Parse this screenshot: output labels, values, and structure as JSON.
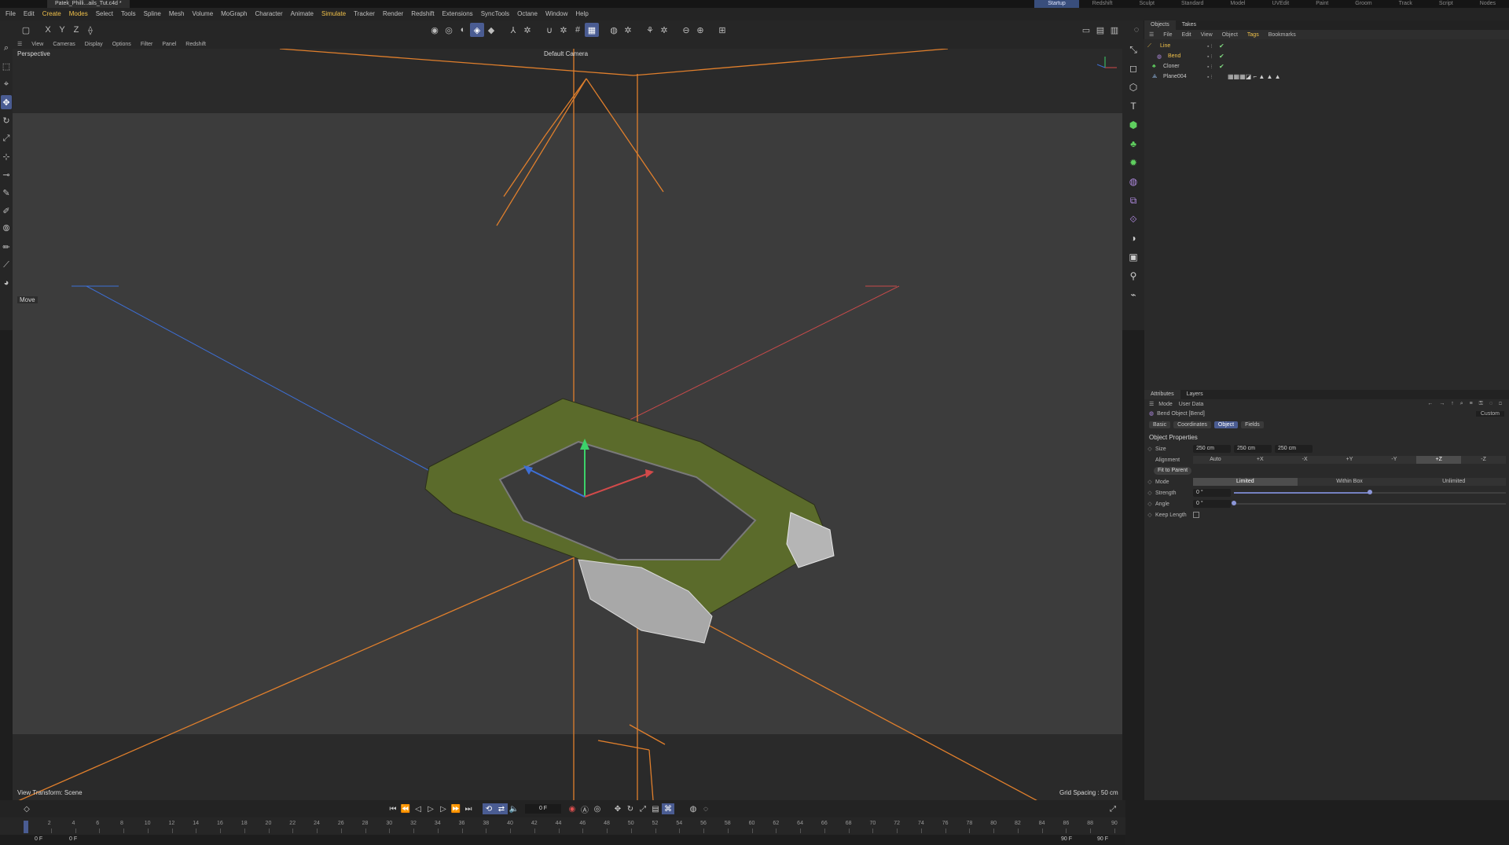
{
  "titlebar": {
    "tab": "Patek_Philli...ails_Tut.c4d *",
    "layouts": [
      "Startup",
      "Redshift",
      "Sculpt",
      "Standard",
      "Model",
      "UVEdit",
      "Paint",
      "Groom",
      "Track",
      "Script",
      "Nodes"
    ],
    "active_layout": "Startup"
  },
  "menubar": [
    "File",
    "Edit",
    "Create",
    "Modes",
    "Select",
    "Tools",
    "Spline",
    "Mesh",
    "Volume",
    "MoGraph",
    "Character",
    "Animate",
    "Simulate",
    "Tracker",
    "Render",
    "Redshift",
    "Extensions",
    "SyncTools",
    "Octane",
    "Window",
    "Help"
  ],
  "toolbar": {
    "axes": [
      "X",
      "Y",
      "Z"
    ]
  },
  "viewport_menu": [
    "View",
    "Cameras",
    "Display",
    "Options",
    "Filter",
    "Panel",
    "Redshift"
  ],
  "viewport": {
    "name": "Perspective",
    "camera": "Default Camera",
    "tool": "Move",
    "view_transform": "View Transform: Scene",
    "grid_spacing": "Grid Spacing : 50 cm",
    "colors": {
      "bg": "#3b3b3b",
      "floor": "#444444",
      "deformer": "#e07f2c",
      "axis_x": "#c84a4a",
      "axis_z": "#3d6fd6"
    }
  },
  "objects_panel": {
    "tabs": [
      "Objects",
      "Takes"
    ],
    "menu": [
      "File",
      "Edit",
      "View",
      "Object",
      "Tags",
      "Bookmarks"
    ],
    "rows": [
      {
        "name": "Line",
        "color": "#f0c14a"
      },
      {
        "name": "Bend",
        "color": "#f0c14a"
      },
      {
        "name": "Cloner",
        "color": "#c8c8c8"
      },
      {
        "name": "Plane004",
        "color": "#c8c8c8"
      }
    ]
  },
  "attributes_panel": {
    "tabs": [
      "Attributes",
      "Layers"
    ],
    "mode_menu": [
      "Mode",
      "User Data"
    ],
    "object_title": "Bend Object [Bend]",
    "preset": "Custom",
    "sub_tabs": [
      "Basic",
      "Coordinates",
      "Object",
      "Fields"
    ],
    "active_sub_tab": "Object",
    "section": "Object Properties",
    "size_label": "Size",
    "size": [
      "250 cm",
      "250 cm",
      "250 cm"
    ],
    "alignment_label": "Alignment",
    "alignment_options": [
      "Auto",
      "+X",
      "-X",
      "+Y",
      "-Y",
      "+Z",
      "-Z"
    ],
    "alignment_selected": "+Z",
    "fit_button": "Fit to Parent",
    "mode_label": "Mode",
    "mode_options": [
      "Limited",
      "Within Box",
      "Unlimited"
    ],
    "mode_selected": "Limited",
    "strength_label": "Strength",
    "strength": "0 °",
    "strength_level": 0.5,
    "angle_label": "Angle",
    "angle": "0 °",
    "angle_level": 0.0,
    "keep_length_label": "Keep Length"
  },
  "timeline": {
    "current_frame": "0 F",
    "ticks": [
      "0",
      "2",
      "4",
      "6",
      "8",
      "10",
      "12",
      "14",
      "16",
      "18",
      "20",
      "22",
      "24",
      "26",
      "28",
      "30",
      "32",
      "34",
      "36",
      "38",
      "40",
      "42",
      "44",
      "46",
      "48",
      "50",
      "52",
      "54",
      "56",
      "58",
      "60",
      "62",
      "64",
      "66",
      "68",
      "70",
      "72",
      "74",
      "76",
      "78",
      "80",
      "82",
      "84",
      "86",
      "88",
      "90"
    ],
    "start": "0 F",
    "min": "0 F",
    "max": "90 F",
    "end": "90 F"
  }
}
